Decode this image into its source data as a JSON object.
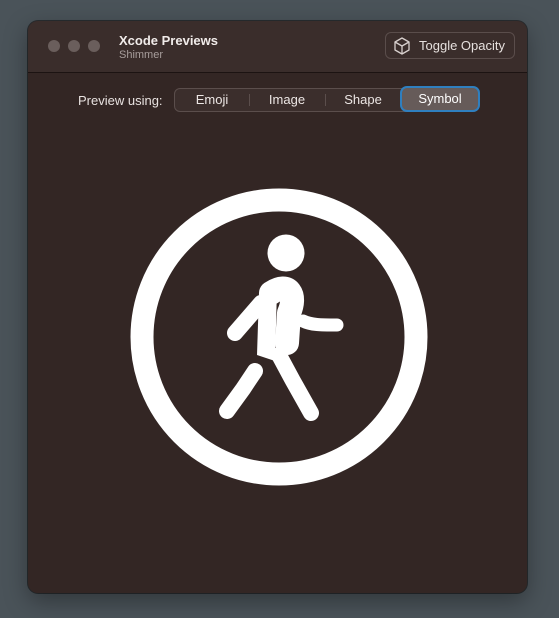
{
  "window": {
    "title": "Xcode Previews",
    "subtitle": "Shimmer",
    "traffic_lights": [
      "close",
      "minimize",
      "zoom"
    ]
  },
  "toolbar": {
    "toggle_label": "Toggle Opacity",
    "toggle_icon": "cube-icon"
  },
  "picker": {
    "label": "Preview using:",
    "options": [
      "Emoji",
      "Image",
      "Shape",
      "Symbol"
    ],
    "selected": "Symbol"
  },
  "preview": {
    "symbol": "figure-walk-circle-icon",
    "colors": {
      "background": "#332624",
      "symbol": "#ffffff",
      "accent": "#2f7fbf"
    }
  }
}
